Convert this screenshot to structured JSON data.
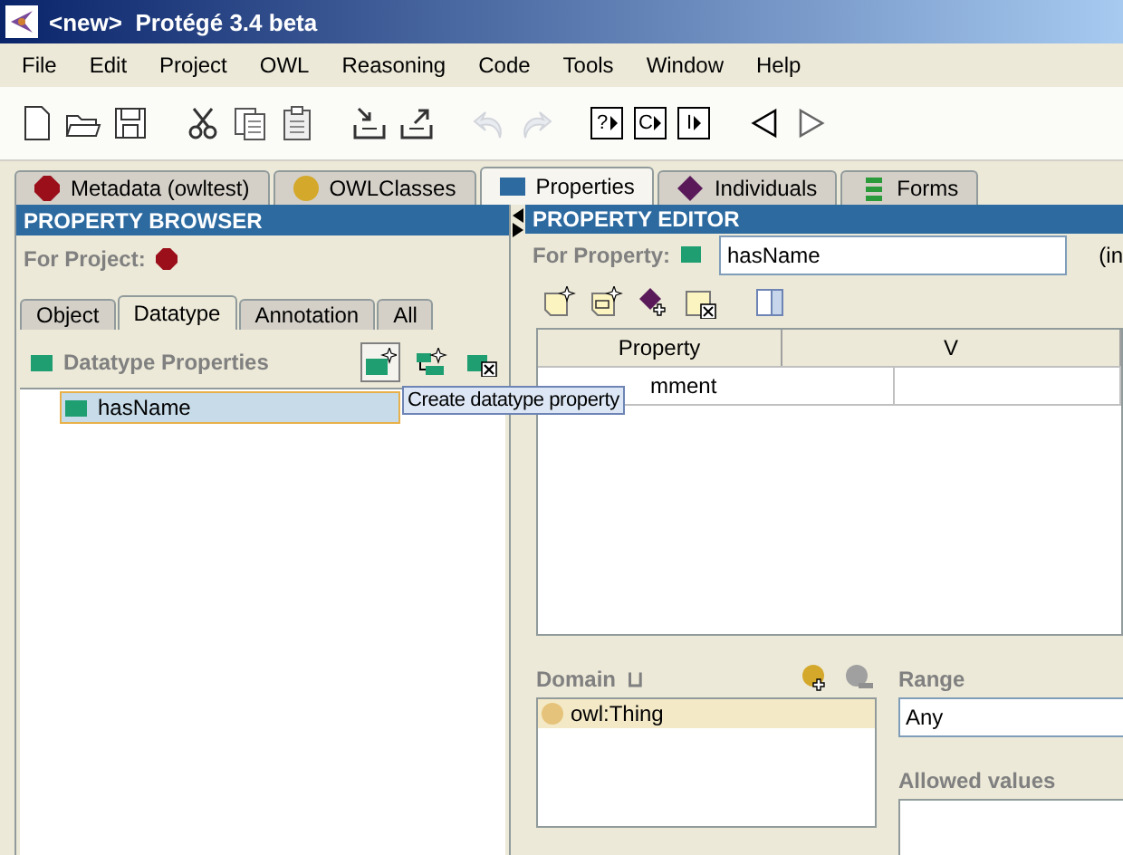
{
  "window": {
    "title": "<new>  Protégé 3.4 beta"
  },
  "menu": [
    "File",
    "Edit",
    "Project",
    "OWL",
    "Reasoning",
    "Code",
    "Tools",
    "Window",
    "Help"
  ],
  "toolbar": [
    {
      "kind": "new",
      "disabled": false
    },
    {
      "kind": "open",
      "disabled": false
    },
    {
      "kind": "save",
      "disabled": false
    },
    {
      "kind": "sep"
    },
    {
      "kind": "cut",
      "disabled": false
    },
    {
      "kind": "copy",
      "disabled": false
    },
    {
      "kind": "paste",
      "disabled": false
    },
    {
      "kind": "sep"
    },
    {
      "kind": "import",
      "disabled": false
    },
    {
      "kind": "export",
      "disabled": false
    },
    {
      "kind": "sep"
    },
    {
      "kind": "undo",
      "disabled": true
    },
    {
      "kind": "redo",
      "disabled": true
    },
    {
      "kind": "sep"
    },
    {
      "kind": "letter",
      "label": "?",
      "disabled": false
    },
    {
      "kind": "letter",
      "label": "C",
      "disabled": false
    },
    {
      "kind": "letter",
      "label": "I",
      "disabled": false
    },
    {
      "kind": "sep"
    },
    {
      "kind": "back",
      "disabled": false
    },
    {
      "kind": "forward",
      "disabled": false
    }
  ],
  "tabs": [
    {
      "label": "Metadata (owltest)",
      "kind": "ontology",
      "selected": false
    },
    {
      "label": "OWLClasses",
      "kind": "class",
      "selected": false
    },
    {
      "label": "Properties",
      "kind": "property",
      "selected": true
    },
    {
      "label": "Individuals",
      "kind": "individual",
      "selected": false
    },
    {
      "label": "Forms",
      "kind": "form",
      "selected": false
    }
  ],
  "property_browser": {
    "title": "PROPERTY BROWSER",
    "for_project_label": "For Project:",
    "tabs": [
      {
        "label": "Object",
        "selected": false
      },
      {
        "label": "Datatype",
        "selected": true
      },
      {
        "label": "Annotation",
        "selected": false
      },
      {
        "label": "All",
        "selected": false
      }
    ],
    "section_title": "Datatype Properties",
    "tree": [
      {
        "label": "hasName",
        "selected": true
      }
    ],
    "tooltip": "Create datatype property"
  },
  "property_editor": {
    "title": "PROPERTY EDITOR",
    "for_property_label": "For Property:",
    "name_value": "hasName",
    "suffix": "(in",
    "table": {
      "columns": [
        "Property",
        "V"
      ],
      "rows": [
        [
          "mment",
          ""
        ]
      ]
    },
    "domain": {
      "label": "Domain",
      "symbol": "⊔",
      "items": [
        {
          "label": "owl:Thing",
          "selected": true
        }
      ]
    },
    "range": {
      "label": "Range",
      "value": "Any"
    },
    "allowed_values": {
      "label": "Allowed values"
    }
  }
}
